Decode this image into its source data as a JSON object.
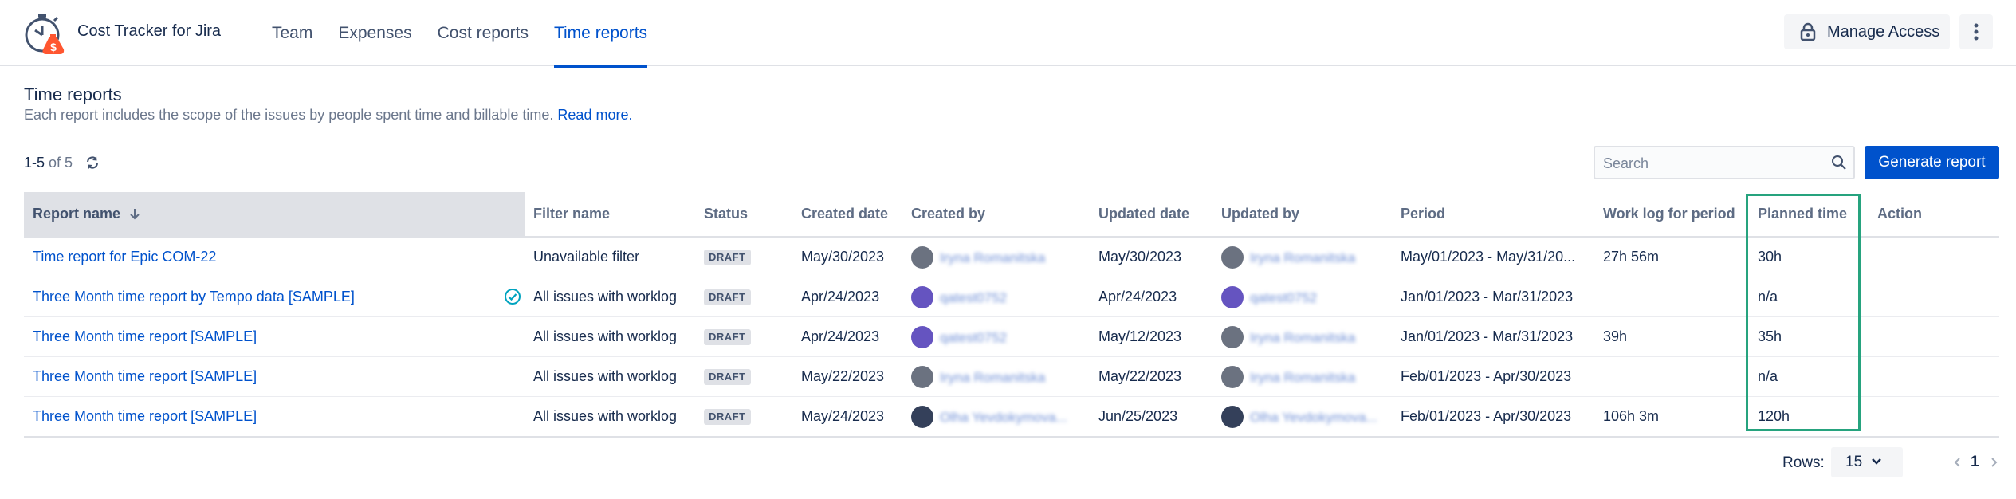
{
  "app": {
    "title": "Cost Tracker for Jira"
  },
  "nav": {
    "tabs": [
      {
        "label": "Team"
      },
      {
        "label": "Expenses"
      },
      {
        "label": "Cost reports"
      },
      {
        "label": "Time reports",
        "active": true
      }
    ]
  },
  "header": {
    "manage_access": "Manage Access"
  },
  "page": {
    "title": "Time reports",
    "description": "Each report includes the scope of the issues by people spent time and billable time.",
    "read_more": "Read more."
  },
  "toolbar": {
    "count_range": "1-5",
    "count_of": "of 5",
    "search_placeholder": "Search",
    "generate_label": "Generate report"
  },
  "table": {
    "columns": {
      "report_name": "Report name",
      "filter_name": "Filter name",
      "status": "Status",
      "created_date": "Created date",
      "created_by": "Created by",
      "updated_date": "Updated date",
      "updated_by": "Updated by",
      "period": "Period",
      "work_log": "Work log for period",
      "planned_time": "Planned time",
      "action": "Action"
    },
    "rows": [
      {
        "report_name": "Time report for Epic COM-22",
        "filter_name": "Unavailable filter",
        "status": "DRAFT",
        "created_date": "May/30/2023",
        "created_by": "Iryna Romanitska",
        "updated_date": "May/30/2023",
        "updated_by": "Iryna Romanitska",
        "period": "May/01/2023 - May/31/20...",
        "work_log": "27h 56m",
        "planned_time": "30h"
      },
      {
        "report_name": "Three Month time report by Tempo data [SAMPLE]",
        "filter_name": "All issues with worklog",
        "status": "DRAFT",
        "created_date": "Apr/24/2023",
        "created_by": "qatest0752",
        "updated_date": "Apr/24/2023",
        "updated_by": "qatest0752",
        "period": "Jan/01/2023 - Mar/31/2023",
        "work_log": "",
        "planned_time": "n/a"
      },
      {
        "report_name": "Three Month time report [SAMPLE]",
        "filter_name": "All issues with worklog",
        "status": "DRAFT",
        "created_date": "Apr/24/2023",
        "created_by": "qatest0752",
        "updated_date": "May/12/2023",
        "updated_by": "Iryna Romanitska",
        "period": "Jan/01/2023 - Mar/31/2023",
        "work_log": "39h",
        "planned_time": "35h"
      },
      {
        "report_name": "Three Month time report [SAMPLE]",
        "filter_name": "All issues with worklog",
        "status": "DRAFT",
        "created_date": "May/22/2023",
        "created_by": "Iryna Romanitska",
        "updated_date": "May/22/2023",
        "updated_by": "Iryna Romanitska",
        "period": "Feb/01/2023 - Apr/30/2023",
        "work_log": "",
        "planned_time": "n/a"
      },
      {
        "report_name": "Three Month time report [SAMPLE]",
        "filter_name": "All issues with worklog",
        "status": "DRAFT",
        "created_date": "May/24/2023",
        "created_by": "Olha Yevdokymova...",
        "updated_date": "Jun/25/2023",
        "updated_by": "Olha Yevdokymova...",
        "period": "Feb/01/2023 - Apr/30/2023",
        "work_log": "106h 3m",
        "planned_time": "120h"
      }
    ]
  },
  "pagination": {
    "rows_label": "Rows:",
    "rows_value": "15",
    "current_page": "1"
  },
  "colors": {
    "accent": "#0052cc",
    "highlight": "#26a37e",
    "logo_orange": "#ff5630"
  }
}
